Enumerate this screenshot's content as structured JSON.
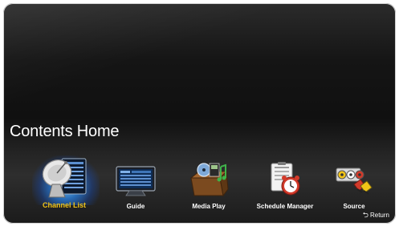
{
  "page": {
    "title": "Contents Home"
  },
  "menu": {
    "items": [
      {
        "label": "Channel List",
        "icon": "satellite-dish-icon",
        "selected": true
      },
      {
        "label": "Guide",
        "icon": "tv-guide-icon",
        "selected": false
      },
      {
        "label": "Media Play",
        "icon": "media-box-icon",
        "selected": false
      },
      {
        "label": "Schedule Manager",
        "icon": "schedule-clock-icon",
        "selected": false
      },
      {
        "label": "Source",
        "icon": "av-connectors-icon",
        "selected": false
      }
    ]
  },
  "footer": {
    "return_label": "Return",
    "return_icon": "return-arrow-icon"
  },
  "colors": {
    "selected_label": "#f2c417",
    "selection_glow": "#2f8be6"
  }
}
